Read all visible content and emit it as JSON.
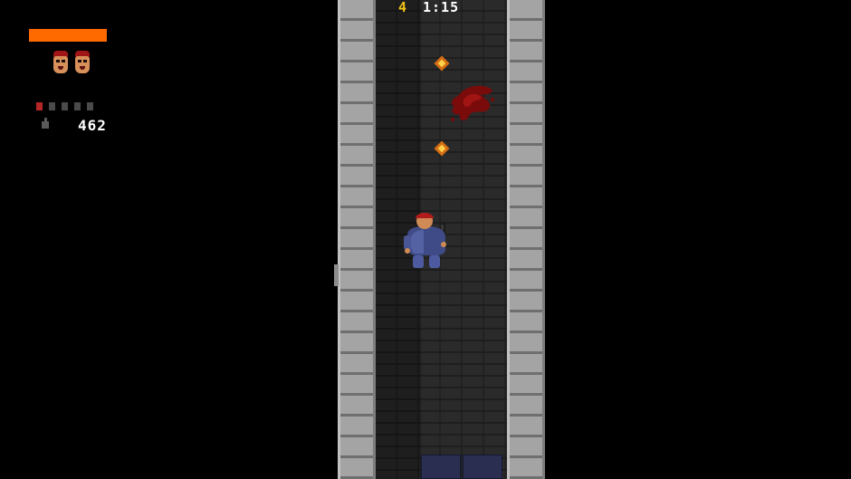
{
  "hud": {
    "health_color": "#ff6a00",
    "health_fraction": 1.0,
    "lives_remaining": 2,
    "lives_icon": "player-face-icon",
    "weapon_slots": 5,
    "selected_weapon_slot": 1,
    "ammo_icon": "grenade-ammo-icon",
    "ammo_count": "462"
  },
  "status": {
    "level": "4",
    "timer": "1:15"
  },
  "map": {
    "wall_color": "#a4a4a4",
    "floor_color": "#2a2a2a",
    "blood_color": "#8b0d0d",
    "projectile_color": "#ffd24a",
    "door_color": "#2a2f52"
  },
  "entities": {
    "player": "player-character",
    "projectiles": 2,
    "blood_splats": 1
  }
}
